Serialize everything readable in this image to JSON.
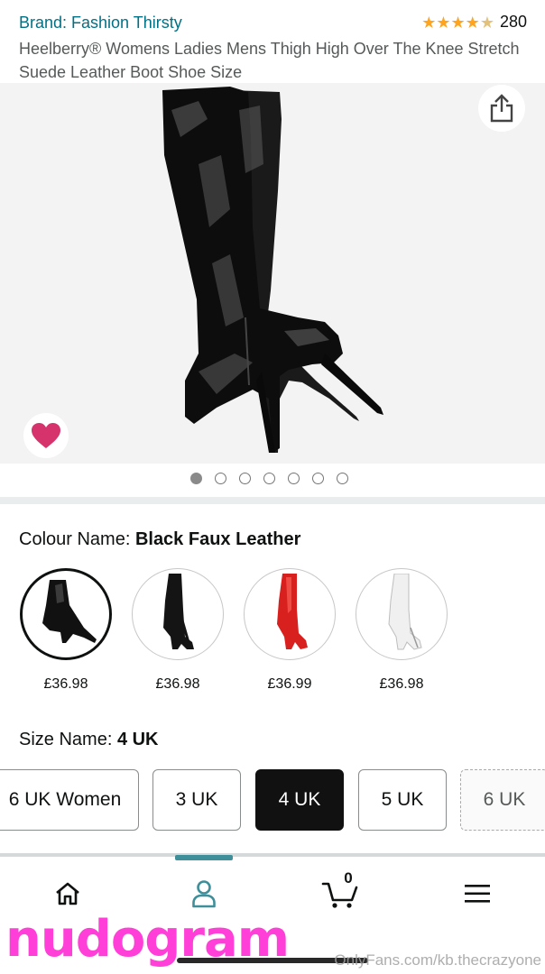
{
  "header": {
    "brand": "Brand: Fashion Thirsty",
    "rating_count": "280",
    "rating_value": 4.5,
    "title": "Heelberry® Womens Ladies Mens Thigh High Over The Knee Stretch Suede Leather Boot Shoe Size"
  },
  "gallery": {
    "image_count": 7,
    "active_index": 0,
    "share_icon": "share-icon",
    "heart_icon": "heart-icon",
    "heart_color": "#d6336c"
  },
  "colour": {
    "label": "Colour Name: ",
    "selected": "Black Faux Leather",
    "swatches": [
      {
        "price": "£36.98",
        "color": "#111111",
        "style": "patent"
      },
      {
        "price": "£36.98",
        "color": "#141414",
        "style": "suede"
      },
      {
        "price": "£36.99",
        "color": "#d8201e",
        "style": "patent"
      },
      {
        "price": "£36.98",
        "color": "#eeeeee",
        "style": "patent"
      }
    ]
  },
  "size": {
    "label": "Size Name: ",
    "selected": "4 UK",
    "options": [
      {
        "label": "6 UK Women",
        "state": "available"
      },
      {
        "label": "3 UK",
        "state": "available"
      },
      {
        "label": "4 UK",
        "state": "selected"
      },
      {
        "label": "5 UK",
        "state": "available"
      },
      {
        "label": "6 UK",
        "state": "unavailable"
      }
    ]
  },
  "bottom_nav": {
    "items": [
      "home-icon",
      "account-icon",
      "cart-icon",
      "menu-icon"
    ],
    "cart_count": "0",
    "active_item": "account-icon",
    "accent": "#3f8f9a"
  },
  "watermark": {
    "logo": "nudogram",
    "url": "OnlyFans.com/kb.thecrazyone"
  }
}
